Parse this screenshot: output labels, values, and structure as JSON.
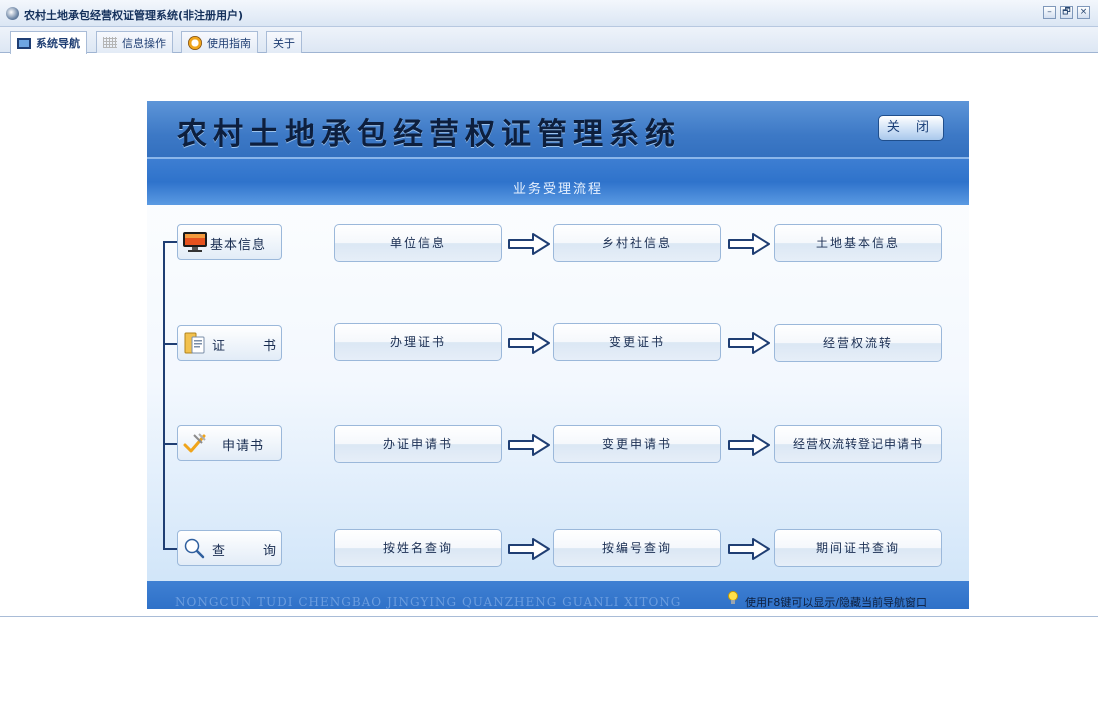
{
  "window": {
    "title": "农村土地承包经营权证管理系统(非注册用户)",
    "buttons": {
      "minimize": "–",
      "restore": "🗗",
      "close": "×"
    }
  },
  "tabs": [
    {
      "label": "系统导航",
      "icon": "monitor-icon",
      "active": true
    },
    {
      "label": "信息操作",
      "icon": "grid-icon",
      "active": false
    },
    {
      "label": "使用指南",
      "icon": "help-icon",
      "active": false
    },
    {
      "label": "关于",
      "icon": "",
      "active": false
    }
  ],
  "panel": {
    "title": "农村土地承包经营权证管理系统",
    "close_label": "关 闭",
    "subtitle": "业务受理流程",
    "rows": [
      {
        "category": "基本信息",
        "icon": "computer-icon",
        "steps": [
          "单位信息",
          "乡村社信息",
          "土地基本信息"
        ]
      },
      {
        "category": "证书",
        "category_parts": [
          "证",
          "书"
        ],
        "icon": "certificate-icon",
        "steps": [
          "办理证书",
          "变更证书",
          "经营权流转"
        ]
      },
      {
        "category": "申请书",
        "icon": "pen-icon",
        "steps": [
          "办证申请书",
          "变更申请书",
          "经营权流转登记申请书"
        ]
      },
      {
        "category": "查询",
        "category_parts": [
          "查",
          "询"
        ],
        "icon": "magnifier-icon",
        "steps": [
          "按姓名查询",
          "按编号查询",
          "期间证书查询"
        ]
      }
    ],
    "footer_pinyin": "NONGCUN TUDI CHENGBAO JINGYING QUANZHENG GUANLI XITONG",
    "footer_hint": "使用F8键可以显示/隐藏当前导航窗口"
  },
  "colors": {
    "header_blue": "#3d79c6",
    "text_dark": "#1a2e52",
    "line": "#1f3e73"
  }
}
